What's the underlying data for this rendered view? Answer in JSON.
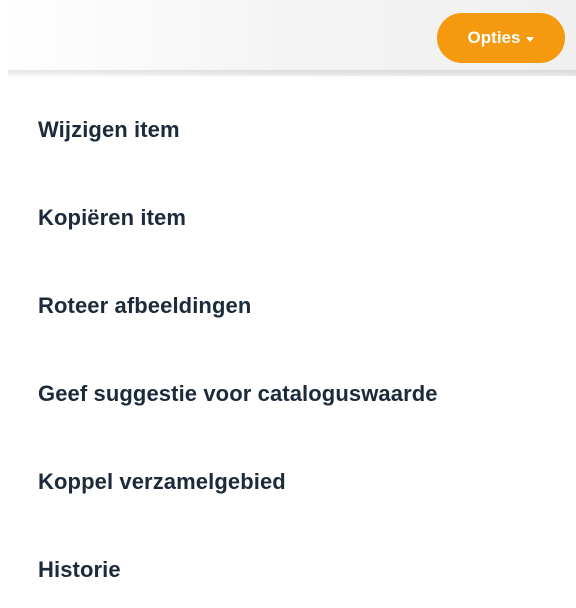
{
  "header": {
    "options_button": {
      "label": "Opties",
      "icon": "caret-down-icon",
      "color": "#f59a0f"
    }
  },
  "menu": {
    "items": [
      {
        "label": "Wijzigen item"
      },
      {
        "label": "Kopiëren item"
      },
      {
        "label": "Roteer afbeeldingen"
      },
      {
        "label": "Geef suggestie voor cataloguswaarde"
      },
      {
        "label": "Koppel verzamelgebied"
      },
      {
        "label": "Historie"
      }
    ],
    "text_color": "#1c2a3a"
  }
}
